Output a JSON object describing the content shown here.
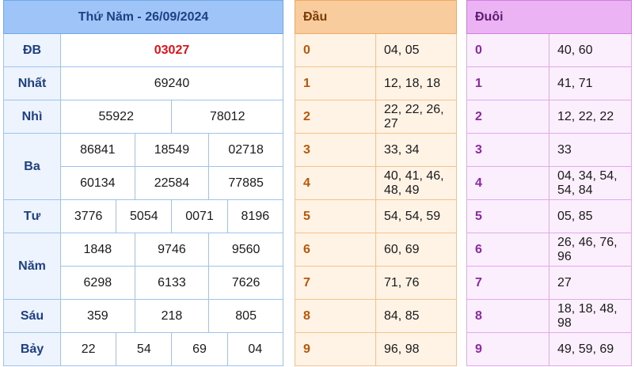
{
  "results": {
    "title": "Thứ Năm - 26/09/2024",
    "prizes": {
      "db": {
        "label": "ĐB",
        "values": [
          "03027"
        ]
      },
      "nhat": {
        "label": "Nhất",
        "values": [
          "69240"
        ]
      },
      "nhi": {
        "label": "Nhì",
        "values": [
          "55922",
          "78012"
        ]
      },
      "ba": {
        "label": "Ba",
        "values": [
          "86841",
          "18549",
          "02718",
          "60134",
          "22584",
          "77885"
        ]
      },
      "tu": {
        "label": "Tư",
        "values": [
          "3776",
          "5054",
          "0071",
          "8196"
        ]
      },
      "nam": {
        "label": "Năm",
        "values": [
          "1848",
          "9746",
          "9560",
          "6298",
          "6133",
          "7626"
        ]
      },
      "sau": {
        "label": "Sáu",
        "values": [
          "359",
          "218",
          "805"
        ]
      },
      "bay": {
        "label": "Bảy",
        "values": [
          "22",
          "54",
          "69",
          "04"
        ]
      }
    },
    "special_color": "#e0131b",
    "header_color": "#9fc5f8"
  },
  "dau": {
    "title": "Đầu",
    "rows": [
      {
        "k": "0",
        "v": "04, 05"
      },
      {
        "k": "1",
        "v": "12, 18, 18"
      },
      {
        "k": "2",
        "v": "22, 22, 26, 27"
      },
      {
        "k": "3",
        "v": "33, 34"
      },
      {
        "k": "4",
        "v": "40, 41, 46, 48, 49"
      },
      {
        "k": "5",
        "v": "54, 54, 59"
      },
      {
        "k": "6",
        "v": "60, 69"
      },
      {
        "k": "7",
        "v": "71, 76"
      },
      {
        "k": "8",
        "v": "84, 85"
      },
      {
        "k": "9",
        "v": "96, 98"
      }
    ],
    "header_color": "#f9cc9e"
  },
  "duoi": {
    "title": "Đuôi",
    "rows": [
      {
        "k": "0",
        "v": "40, 60"
      },
      {
        "k": "1",
        "v": "41, 71"
      },
      {
        "k": "2",
        "v": "12, 22, 22"
      },
      {
        "k": "3",
        "v": "33"
      },
      {
        "k": "4",
        "v": "04, 34, 54, 54, 84"
      },
      {
        "k": "5",
        "v": "05, 85"
      },
      {
        "k": "6",
        "v": "26, 46, 76, 96"
      },
      {
        "k": "7",
        "v": "27"
      },
      {
        "k": "8",
        "v": "18, 18, 48, 98"
      },
      {
        "k": "9",
        "v": "49, 59, 69"
      }
    ],
    "header_color": "#ebb3f3"
  }
}
